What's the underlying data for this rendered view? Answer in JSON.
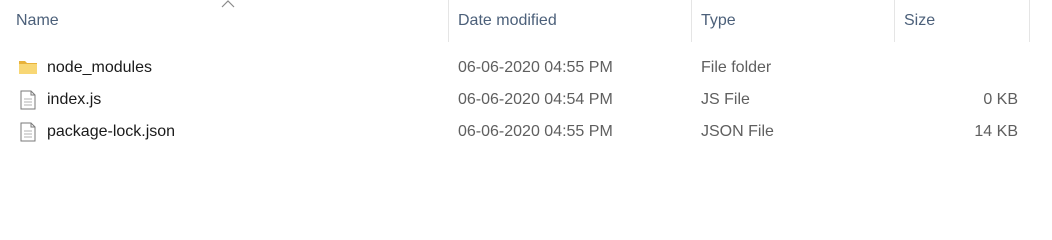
{
  "columns": {
    "name": "Name",
    "date_modified": "Date modified",
    "type": "Type",
    "size": "Size"
  },
  "sort": {
    "column": "name",
    "direction": "ascending",
    "indicator_icon": "chevron-up-icon"
  },
  "files": [
    {
      "name": "node_modules",
      "date_modified": "06-06-2020 04:55 PM",
      "type": "File folder",
      "size": "",
      "icon": "folder-icon"
    },
    {
      "name": "index.js",
      "date_modified": "06-06-2020 04:54 PM",
      "type": "JS File",
      "size": "0 KB",
      "icon": "document-icon"
    },
    {
      "name": "package-lock.json",
      "date_modified": "06-06-2020 04:55 PM",
      "type": "JSON File",
      "size": "14 KB",
      "icon": "document-icon"
    }
  ],
  "colors": {
    "header_text": "#4c607a",
    "row_text": "#1a1a1a",
    "secondary_text": "#5f5f5f",
    "folder_yellow": "#e8b23a"
  }
}
